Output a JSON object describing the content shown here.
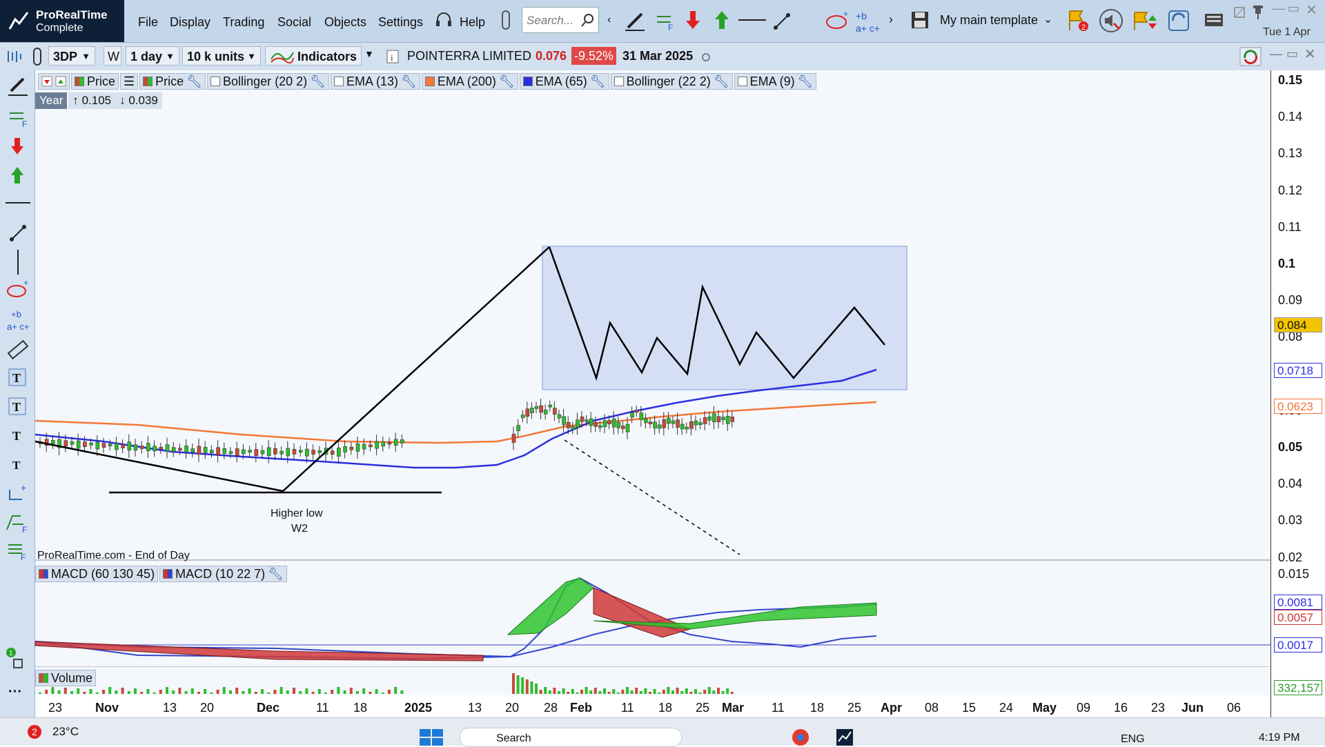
{
  "app": {
    "name": "ProRealTime",
    "edition": "Complete"
  },
  "menu": [
    "File",
    "Display",
    "Trading",
    "Social",
    "Objects",
    "Settings",
    "Help"
  ],
  "search": {
    "placeholder": "Search..."
  },
  "template": {
    "label": "My main template"
  },
  "date_header": "Tue 1 Apr",
  "toolbar": {
    "ticker": "3DP",
    "period_letter": "W",
    "interval": "1 day",
    "units": "10 k units",
    "indicators_label": "Indicators",
    "instrument": "POINTERRA LIMITED",
    "last_price": "0.076",
    "change_pct": "-9.52%",
    "date": "31 Mar 2025"
  },
  "legend": {
    "price1": "Price",
    "price2": "Price",
    "items": [
      "Bollinger (20 2)",
      "EMA (13)",
      "EMA (200)",
      "EMA (65)",
      "Bollinger (22 2)",
      "EMA (9)"
    ],
    "year_label": "Year",
    "year_high": "↑ 0.105",
    "year_low": "↓ 0.039"
  },
  "colors": {
    "ema200": "#f37736",
    "ema65": "#2a2ee0",
    "up": "#2bbf2b",
    "down": "#c94a3a",
    "box": "#c9d7f3"
  },
  "annotations": {
    "higher_low": "Higher low",
    "w2": "W2",
    "source": "ProRealTime.com - End of Day"
  },
  "price_axis": {
    "ticks": [
      "0.15",
      "0.14",
      "0.13",
      "0.12",
      "0.11",
      "0.1",
      "0.09",
      "0.08",
      "0.07",
      "0.06",
      "0.05",
      "0.04",
      "0.03",
      "0.02"
    ],
    "current_tag": "0.084",
    "ema65_tag": "0.0718",
    "ema200_tag": "0.0623"
  },
  "macd": {
    "legend": [
      "MACD (60 130 45)",
      "MACD (10 22 7)"
    ],
    "ticks": [
      "0.015"
    ],
    "tags": [
      "0.0081",
      "0.0057",
      "0.0017"
    ]
  },
  "volume": {
    "legend": "Volume",
    "tag": "332,157"
  },
  "x_axis": {
    "labels": [
      {
        "t": "23",
        "b": false
      },
      {
        "t": "Nov",
        "b": true
      },
      {
        "t": "13",
        "b": false
      },
      {
        "t": "20",
        "b": false
      },
      {
        "t": "Dec",
        "b": true
      },
      {
        "t": "11",
        "b": false
      },
      {
        "t": "18",
        "b": false
      },
      {
        "t": "2025",
        "b": true
      },
      {
        "t": "13",
        "b": false
      },
      {
        "t": "20",
        "b": false
      },
      {
        "t": "28",
        "b": false
      },
      {
        "t": "Feb",
        "b": true
      },
      {
        "t": "11",
        "b": false
      },
      {
        "t": "18",
        "b": false
      },
      {
        "t": "25",
        "b": false
      },
      {
        "t": "Mar",
        "b": true
      },
      {
        "t": "11",
        "b": false
      },
      {
        "t": "18",
        "b": false
      },
      {
        "t": "25",
        "b": false
      },
      {
        "t": "Apr",
        "b": true
      },
      {
        "t": "08",
        "b": false
      },
      {
        "t": "15",
        "b": false
      },
      {
        "t": "24",
        "b": false
      },
      {
        "t": "May",
        "b": true
      },
      {
        "t": "09",
        "b": false
      },
      {
        "t": "16",
        "b": false
      },
      {
        "t": "23",
        "b": false
      },
      {
        "t": "Jun",
        "b": true
      },
      {
        "t": "06",
        "b": false
      }
    ]
  },
  "taskbar": {
    "weather": "23°C",
    "notif": "2",
    "search": "Search",
    "lang": "ENG",
    "time": "4:19 PM"
  }
}
